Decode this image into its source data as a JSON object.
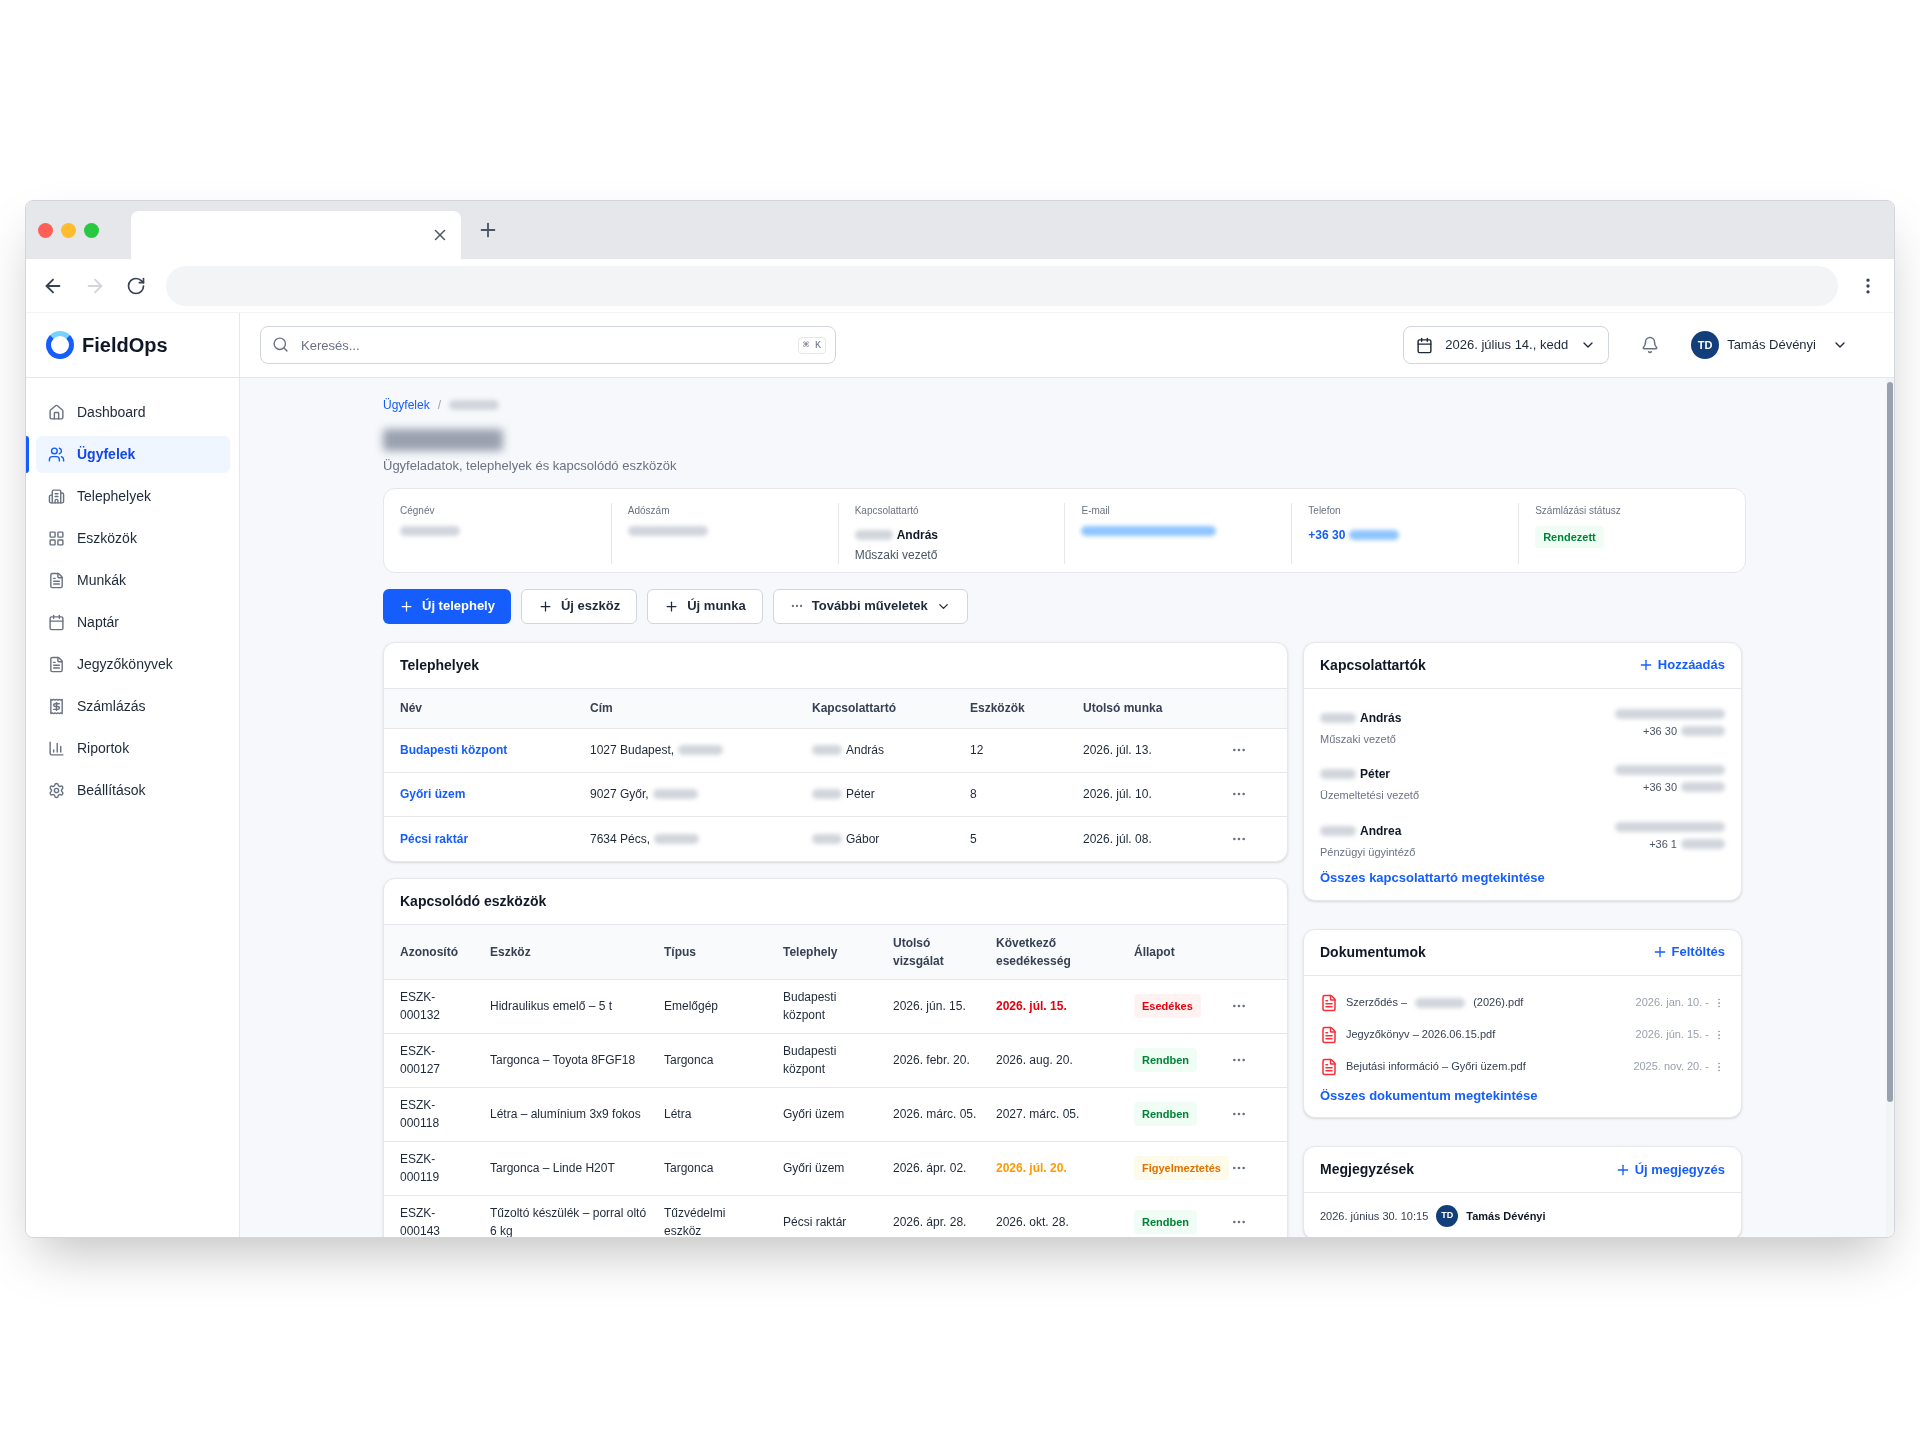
{
  "browser": {
    "forward_disabled": true
  },
  "app": {
    "logo": "FieldOps",
    "search": {
      "placeholder": "Keresés...",
      "shortcut": "⌘ K"
    },
    "date": "2026. július 14., kedd",
    "user": {
      "initials": "TD",
      "name": "Tamás Dévényi"
    }
  },
  "sidebar": {
    "items": [
      {
        "label": "Dashboard",
        "selected": false
      },
      {
        "label": "Ügyfelek",
        "selected": true
      },
      {
        "label": "Telephelyek",
        "selected": false
      },
      {
        "label": "Eszközök",
        "selected": false
      },
      {
        "label": "Munkák",
        "selected": false
      },
      {
        "label": "Naptár",
        "selected": false
      },
      {
        "label": "Jegyzőkönyvek",
        "selected": false
      },
      {
        "label": "Számlázás",
        "selected": false
      },
      {
        "label": "Riportok",
        "selected": false
      },
      {
        "label": "Beállítások",
        "selected": false
      }
    ]
  },
  "breadcrumb": [
    "Ügyfelek"
  ],
  "breadcrumb_separator": "/",
  "subtitle": "Ügyfeladatok, telephelyek és kapcsolódó eszközök",
  "info": [
    {
      "label": "Cégnév",
      "kind": "redacted"
    },
    {
      "label": "Adószám",
      "kind": "redacted"
    },
    {
      "label": "Kapcsolattartó",
      "kind": "contact",
      "value": "András",
      "role": "Műszaki vezető"
    },
    {
      "label": "E-mail",
      "kind": "redacted_link"
    },
    {
      "label": "Telefon",
      "kind": "phone",
      "value": "+36 30"
    },
    {
      "label": "Számlázási státusz",
      "kind": "badge",
      "value": "Rendezett"
    }
  ],
  "actions": [
    {
      "label": "Új telephely",
      "kind": "primary"
    },
    {
      "label": "Új eszköz",
      "kind": "add"
    },
    {
      "label": "Új munka",
      "kind": "add"
    },
    {
      "label": "További műveletek",
      "kind": "menu"
    }
  ],
  "sites": {
    "title": "Telephelyek",
    "columns": [
      "Név",
      "Cím",
      "Kapcsolattartó",
      "Eszközök",
      "Utolsó munka"
    ],
    "rows": [
      {
        "name": "Budapesti központ",
        "address": "1027 Budapest,",
        "contact": "András",
        "assets": "12",
        "last_job": "2026. júl. 13."
      },
      {
        "name": "Győri üzem",
        "address": "9027 Győr,",
        "contact": "Péter",
        "assets": "8",
        "last_job": "2026. júl. 10."
      },
      {
        "name": "Pécsi raktár",
        "address": "7634 Pécs,",
        "contact": "Gábor",
        "assets": "5",
        "last_job": "2026. júl. 08."
      }
    ]
  },
  "assets": {
    "title": "Kapcsolódó eszközök",
    "columns": [
      "Azonosító",
      "Eszköz",
      "Típus",
      "Telephely",
      "Utolsó vizsgálat",
      "Következő esedékesség",
      "Állapot"
    ],
    "rows": [
      {
        "id": "ESZK-000132",
        "name": "Hidraulikus emelő – 5 t",
        "type": "Emelőgép",
        "site": "Budapesti központ",
        "last_check": "2026. jún. 15.",
        "next_due": "2026. júl. 15.",
        "status": "Esedékes",
        "kind": "danger"
      },
      {
        "id": "ESZK-000127",
        "name": "Targonca – Toyota 8FGF18",
        "type": "Targonca",
        "site": "Budapesti központ",
        "last_check": "2026. febr. 20.",
        "next_due": "2026. aug. 20.",
        "status": "Rendben",
        "kind": "ok"
      },
      {
        "id": "ESZK-000118",
        "name": "Létra – alumínium 3x9 fokos",
        "type": "Létra",
        "site": "Győri üzem",
        "last_check": "2026. márc. 05.",
        "next_due": "2027. márc. 05.",
        "status": "Rendben",
        "kind": "ok"
      },
      {
        "id": "ESZK-000119",
        "name": "Targonca – Linde H20T",
        "type": "Targonca",
        "site": "Győri üzem",
        "last_check": "2026. ápr. 02.",
        "next_due": "2026. júl. 20.",
        "status": "Figyelmeztetés",
        "kind": "warning"
      },
      {
        "id": "ESZK-000143",
        "name": "Tűzoltó készülék – porral oltó 6 kg",
        "type": "Tűzvédelmi eszköz",
        "site": "Pécsi raktár",
        "last_check": "2026. ápr. 28.",
        "next_due": "2026. okt. 28.",
        "status": "Rendben",
        "kind": "ok"
      }
    ]
  },
  "contacts": {
    "title": "Kapcsolattartók",
    "action": "Hozzáadás",
    "items": [
      {
        "name": "András",
        "role": "Műszaki vezető",
        "phone": "+36 30"
      },
      {
        "name": "Péter",
        "role": "Üzemeltetési vezető",
        "phone": "+36 30"
      },
      {
        "name": "Andrea",
        "role": "Pénzügyi ügyintéző",
        "phone": "+36 1"
      }
    ],
    "link": "Összes kapcsolattartó megtekintése"
  },
  "documents": {
    "title": "Dokumentumok",
    "action": "Feltöltés",
    "items": [
      {
        "name": "Szerződés –",
        "suffix": "(2026).pdf",
        "date": "2026. jan. 10. -"
      },
      {
        "name": "Jegyzőkönyv – 2026.06.15.pdf",
        "date": "2026. jún. 15. -"
      },
      {
        "name": "Bejutási információ – Győri üzem.pdf",
        "date": "2025. nov. 20. -"
      }
    ],
    "link": "Összes dokumentum megtekintése"
  },
  "notes": {
    "title": "Megjegyzések",
    "action": "Új megjegyzés",
    "items": [
      {
        "timestamp": "2026. június 30. 10:15",
        "initials": "TD",
        "author": "Tamás Dévényi"
      }
    ]
  }
}
